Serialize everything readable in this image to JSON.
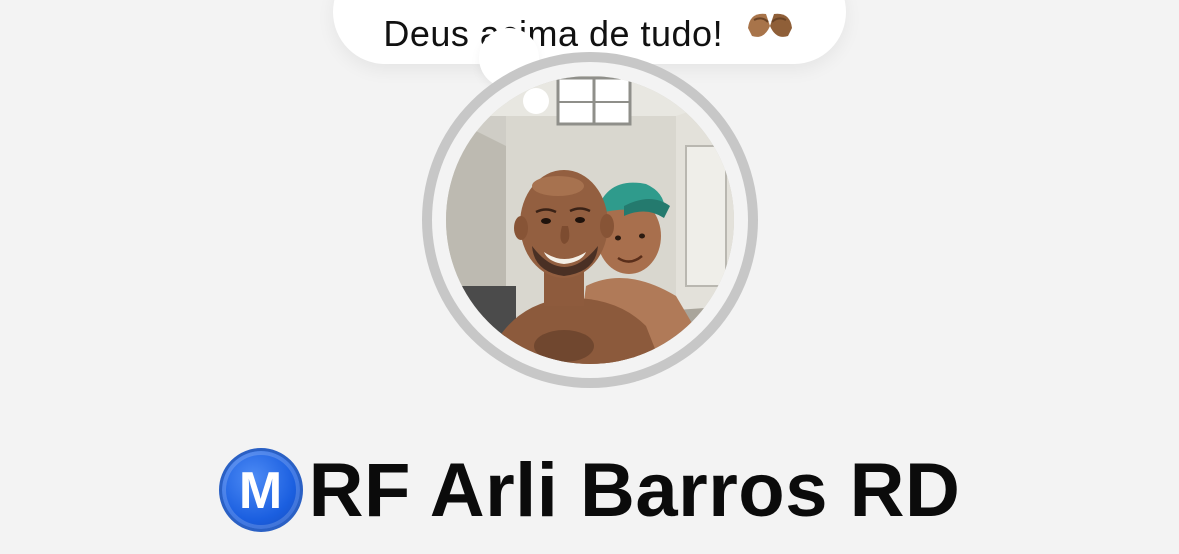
{
  "note": {
    "text": "Deus acima de tudo!",
    "emoji": "folded-hands-emoji"
  },
  "profile": {
    "avatar": "profile-photo",
    "badge_letter": "M",
    "name": "RF Arli Barros RD"
  },
  "colors": {
    "background": "#f3f3f3",
    "avatar_ring": "#c7c7c7",
    "badge_blue": "#1b5fe0",
    "text": "#0b0b0b"
  }
}
